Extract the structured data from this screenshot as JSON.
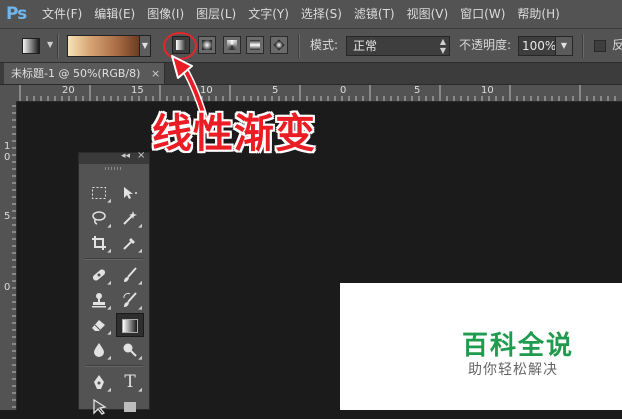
{
  "app": {
    "logo": "Ps"
  },
  "menu": [
    "文件(F)",
    "编辑(E)",
    "图像(I)",
    "图层(L)",
    "文字(Y)",
    "选择(S)",
    "滤镜(T)",
    "视图(V)",
    "窗口(W)",
    "帮助(H)"
  ],
  "options": {
    "mode_label": "模式:",
    "mode_value": "正常",
    "opacity_label": "不透明度:",
    "opacity_value": "100%",
    "reverse_label": "反",
    "gradient_types": [
      "linear",
      "radial",
      "angle",
      "reflected",
      "diamond"
    ],
    "selected_type": "linear"
  },
  "document": {
    "tab_title": "未标题-1 @ 50%(RGB/8)",
    "close_glyph": "×"
  },
  "ruler": {
    "top_numbers": [
      "20",
      "15",
      "10",
      "5",
      "0",
      "5",
      "10"
    ],
    "left_numbers": [
      "1",
      "0",
      "5",
      "0"
    ]
  },
  "annotation": {
    "label": "线性渐变",
    "color": "#ea1d24"
  },
  "toolpanel": {
    "collapse_glyph": "◂◂",
    "close_glyph": "×"
  },
  "watermark": {
    "title": "百科全说",
    "subtitle": "助你轻松解决",
    "title_color": "#1e9b4c"
  }
}
